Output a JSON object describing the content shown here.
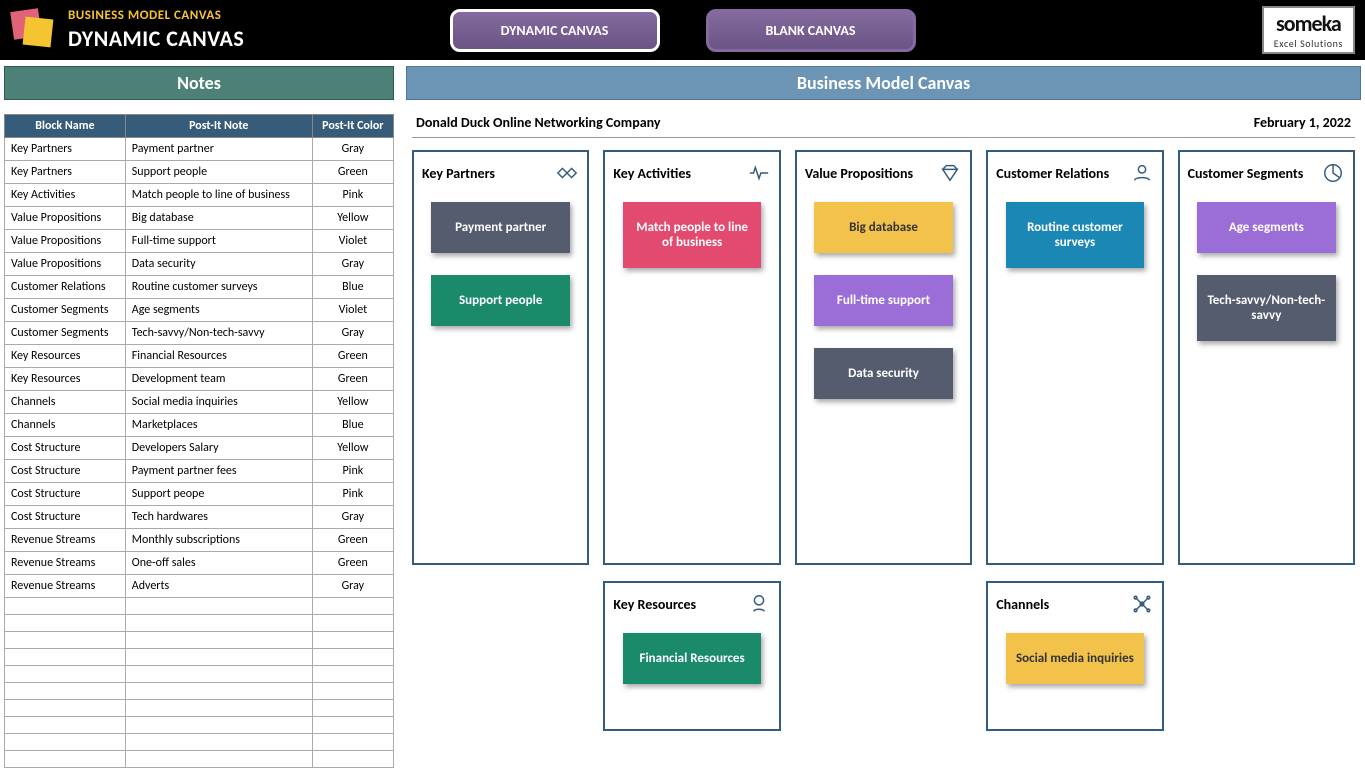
{
  "header": {
    "title_small": "BUSINESS MODEL CANVAS",
    "title_large": "DYNAMIC CANVAS",
    "tab_dynamic": "DYNAMIC CANVAS",
    "tab_blank": "BLANK CANVAS",
    "logo_line1": "someka",
    "logo_line2": "Excel Solutions"
  },
  "subheaders": {
    "notes": "Notes",
    "canvas": "Business Model Canvas"
  },
  "table": {
    "h1": "Block Name",
    "h2": "Post-It Note",
    "h3": "Post-It Color",
    "rows": [
      {
        "a": "Key Partners",
        "b": "Payment partner",
        "c": "Gray"
      },
      {
        "a": "Key Partners",
        "b": "Support people",
        "c": "Green"
      },
      {
        "a": "Key Activities",
        "b": "Match people to line of business",
        "c": "Pink"
      },
      {
        "a": "Value Propositions",
        "b": "Big database",
        "c": "Yellow"
      },
      {
        "a": "Value Propositions",
        "b": "Full-time support",
        "c": "Violet"
      },
      {
        "a": "Value Propositions",
        "b": "Data security",
        "c": "Gray"
      },
      {
        "a": "Customer Relations",
        "b": "Routine customer surveys",
        "c": "Blue"
      },
      {
        "a": "Customer Segments",
        "b": "Age segments",
        "c": "Violet"
      },
      {
        "a": "Customer Segments",
        "b": "Tech-savvy/Non-tech-savvy",
        "c": "Gray"
      },
      {
        "a": "Key Resources",
        "b": "Financial Resources",
        "c": "Green"
      },
      {
        "a": "Key Resources",
        "b": "Development team",
        "c": "Green"
      },
      {
        "a": "Channels",
        "b": "Social media inquiries",
        "c": "Yellow"
      },
      {
        "a": "Channels",
        "b": "Marketplaces",
        "c": "Blue"
      },
      {
        "a": "Cost Structure",
        "b": "Developers Salary",
        "c": "Yellow"
      },
      {
        "a": "Cost Structure",
        "b": "Payment partner fees",
        "c": "Pink"
      },
      {
        "a": "Cost Structure",
        "b": "Support peope",
        "c": "Pink"
      },
      {
        "a": "Cost Structure",
        "b": "Tech hardwares",
        "c": "Gray"
      },
      {
        "a": "Revenue Streams",
        "b": "Monthly subscriptions",
        "c": "Green"
      },
      {
        "a": "Revenue Streams",
        "b": "One-off sales",
        "c": "Green"
      },
      {
        "a": "Revenue Streams",
        "b": "Adverts",
        "c": "Gray"
      },
      {
        "a": "",
        "b": "",
        "c": ""
      },
      {
        "a": "",
        "b": "",
        "c": ""
      },
      {
        "a": "",
        "b": "",
        "c": ""
      },
      {
        "a": "",
        "b": "",
        "c": ""
      },
      {
        "a": "",
        "b": "",
        "c": ""
      },
      {
        "a": "",
        "b": "",
        "c": ""
      },
      {
        "a": "",
        "b": "",
        "c": ""
      },
      {
        "a": "",
        "b": "",
        "c": ""
      },
      {
        "a": "",
        "b": "",
        "c": ""
      },
      {
        "a": "",
        "b": "",
        "c": ""
      }
    ]
  },
  "canvas": {
    "company": "Donald Duck Online Networking Company",
    "date": "February 1, 2022",
    "blocks": {
      "key_partners": {
        "title": "Key Partners",
        "items": [
          {
            "label": "Payment partner",
            "clr": "gray"
          },
          {
            "label": "Support people",
            "clr": "green"
          }
        ]
      },
      "key_activities": {
        "title": "Key Activities",
        "items": [
          {
            "label": "Match people to line of business",
            "clr": "pink"
          }
        ]
      },
      "key_resources": {
        "title": "Key Resources",
        "items": [
          {
            "label": "Financial Resources",
            "clr": "green"
          }
        ]
      },
      "value_propositions": {
        "title": "Value Propositions",
        "items": [
          {
            "label": "Big database",
            "clr": "yellow"
          },
          {
            "label": "Full-time support",
            "clr": "violet"
          },
          {
            "label": "Data security",
            "clr": "gray"
          }
        ]
      },
      "customer_relations": {
        "title": "Customer Relations",
        "items": [
          {
            "label": "Routine customer surveys",
            "clr": "blue"
          }
        ]
      },
      "channels": {
        "title": "Channels",
        "items": [
          {
            "label": "Social media inquiries",
            "clr": "yellow"
          }
        ]
      },
      "customer_segments": {
        "title": "Customer Segments",
        "items": [
          {
            "label": "Age segments",
            "clr": "violet"
          },
          {
            "label": "Tech-savvy/Non-tech-savvy",
            "clr": "gray"
          }
        ]
      }
    }
  }
}
